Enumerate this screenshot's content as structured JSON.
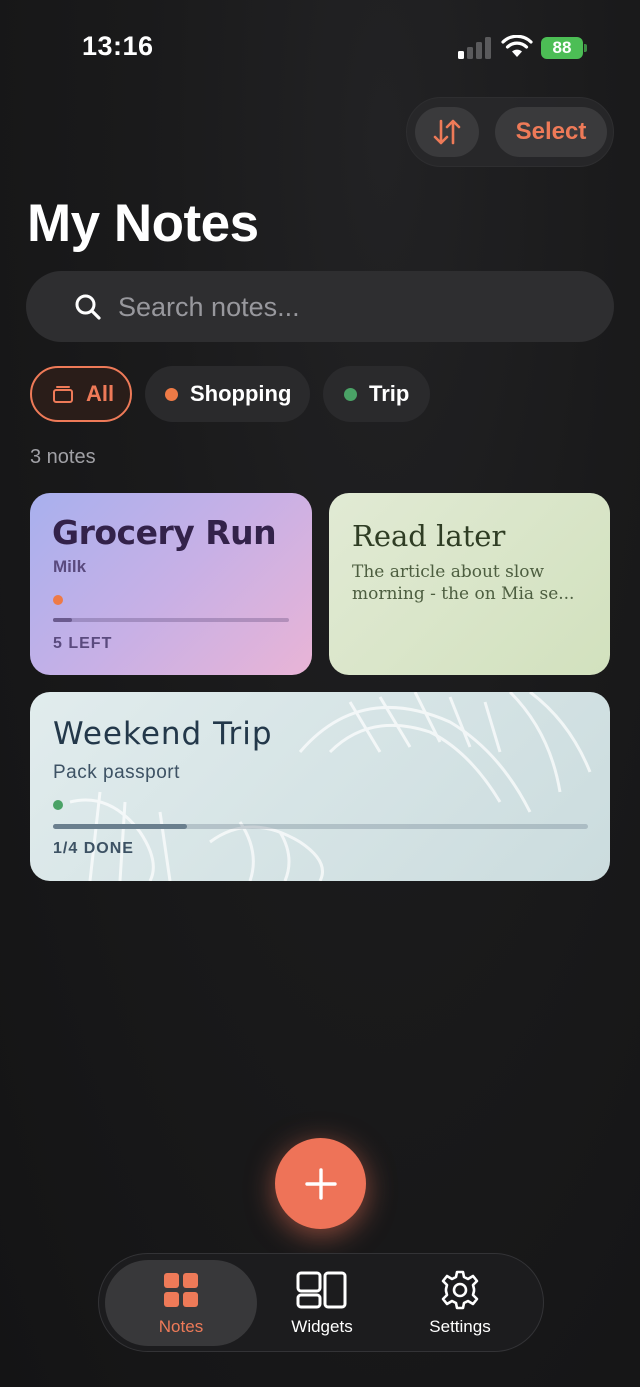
{
  "status_bar": {
    "time": "13:16",
    "battery": "88"
  },
  "toolbar": {
    "select_label": "Select"
  },
  "page": {
    "title": "My Notes"
  },
  "search": {
    "placeholder": "Search notes..."
  },
  "filters": [
    {
      "label": "All",
      "selected": true,
      "color": "#ee7a58"
    },
    {
      "label": "Shopping",
      "selected": false,
      "color": "#ee7a46"
    },
    {
      "label": "Trip",
      "selected": false,
      "color": "#4aa266"
    }
  ],
  "notes_count": "3 notes",
  "notes": [
    {
      "title": "Grocery Run",
      "subtitle": "Milk",
      "status": "5 LEFT",
      "progress": 0.08,
      "tag_color": "#ee7a46"
    },
    {
      "title": "Read later",
      "body": "The article about slow morning - the on Mia se..."
    },
    {
      "title": "Weekend Trip",
      "subtitle": "Pack passport",
      "status": "1/4 DONE",
      "progress": 0.25,
      "tag_color": "#4aa266"
    }
  ],
  "tabs": [
    {
      "label": "Notes",
      "icon": "grid-icon",
      "active": true
    },
    {
      "label": "Widgets",
      "icon": "widgets-icon",
      "active": false
    },
    {
      "label": "Settings",
      "icon": "gear-icon",
      "active": false
    }
  ],
  "colors": {
    "accent": "#ee7a58",
    "background": "#1a1a1b"
  }
}
